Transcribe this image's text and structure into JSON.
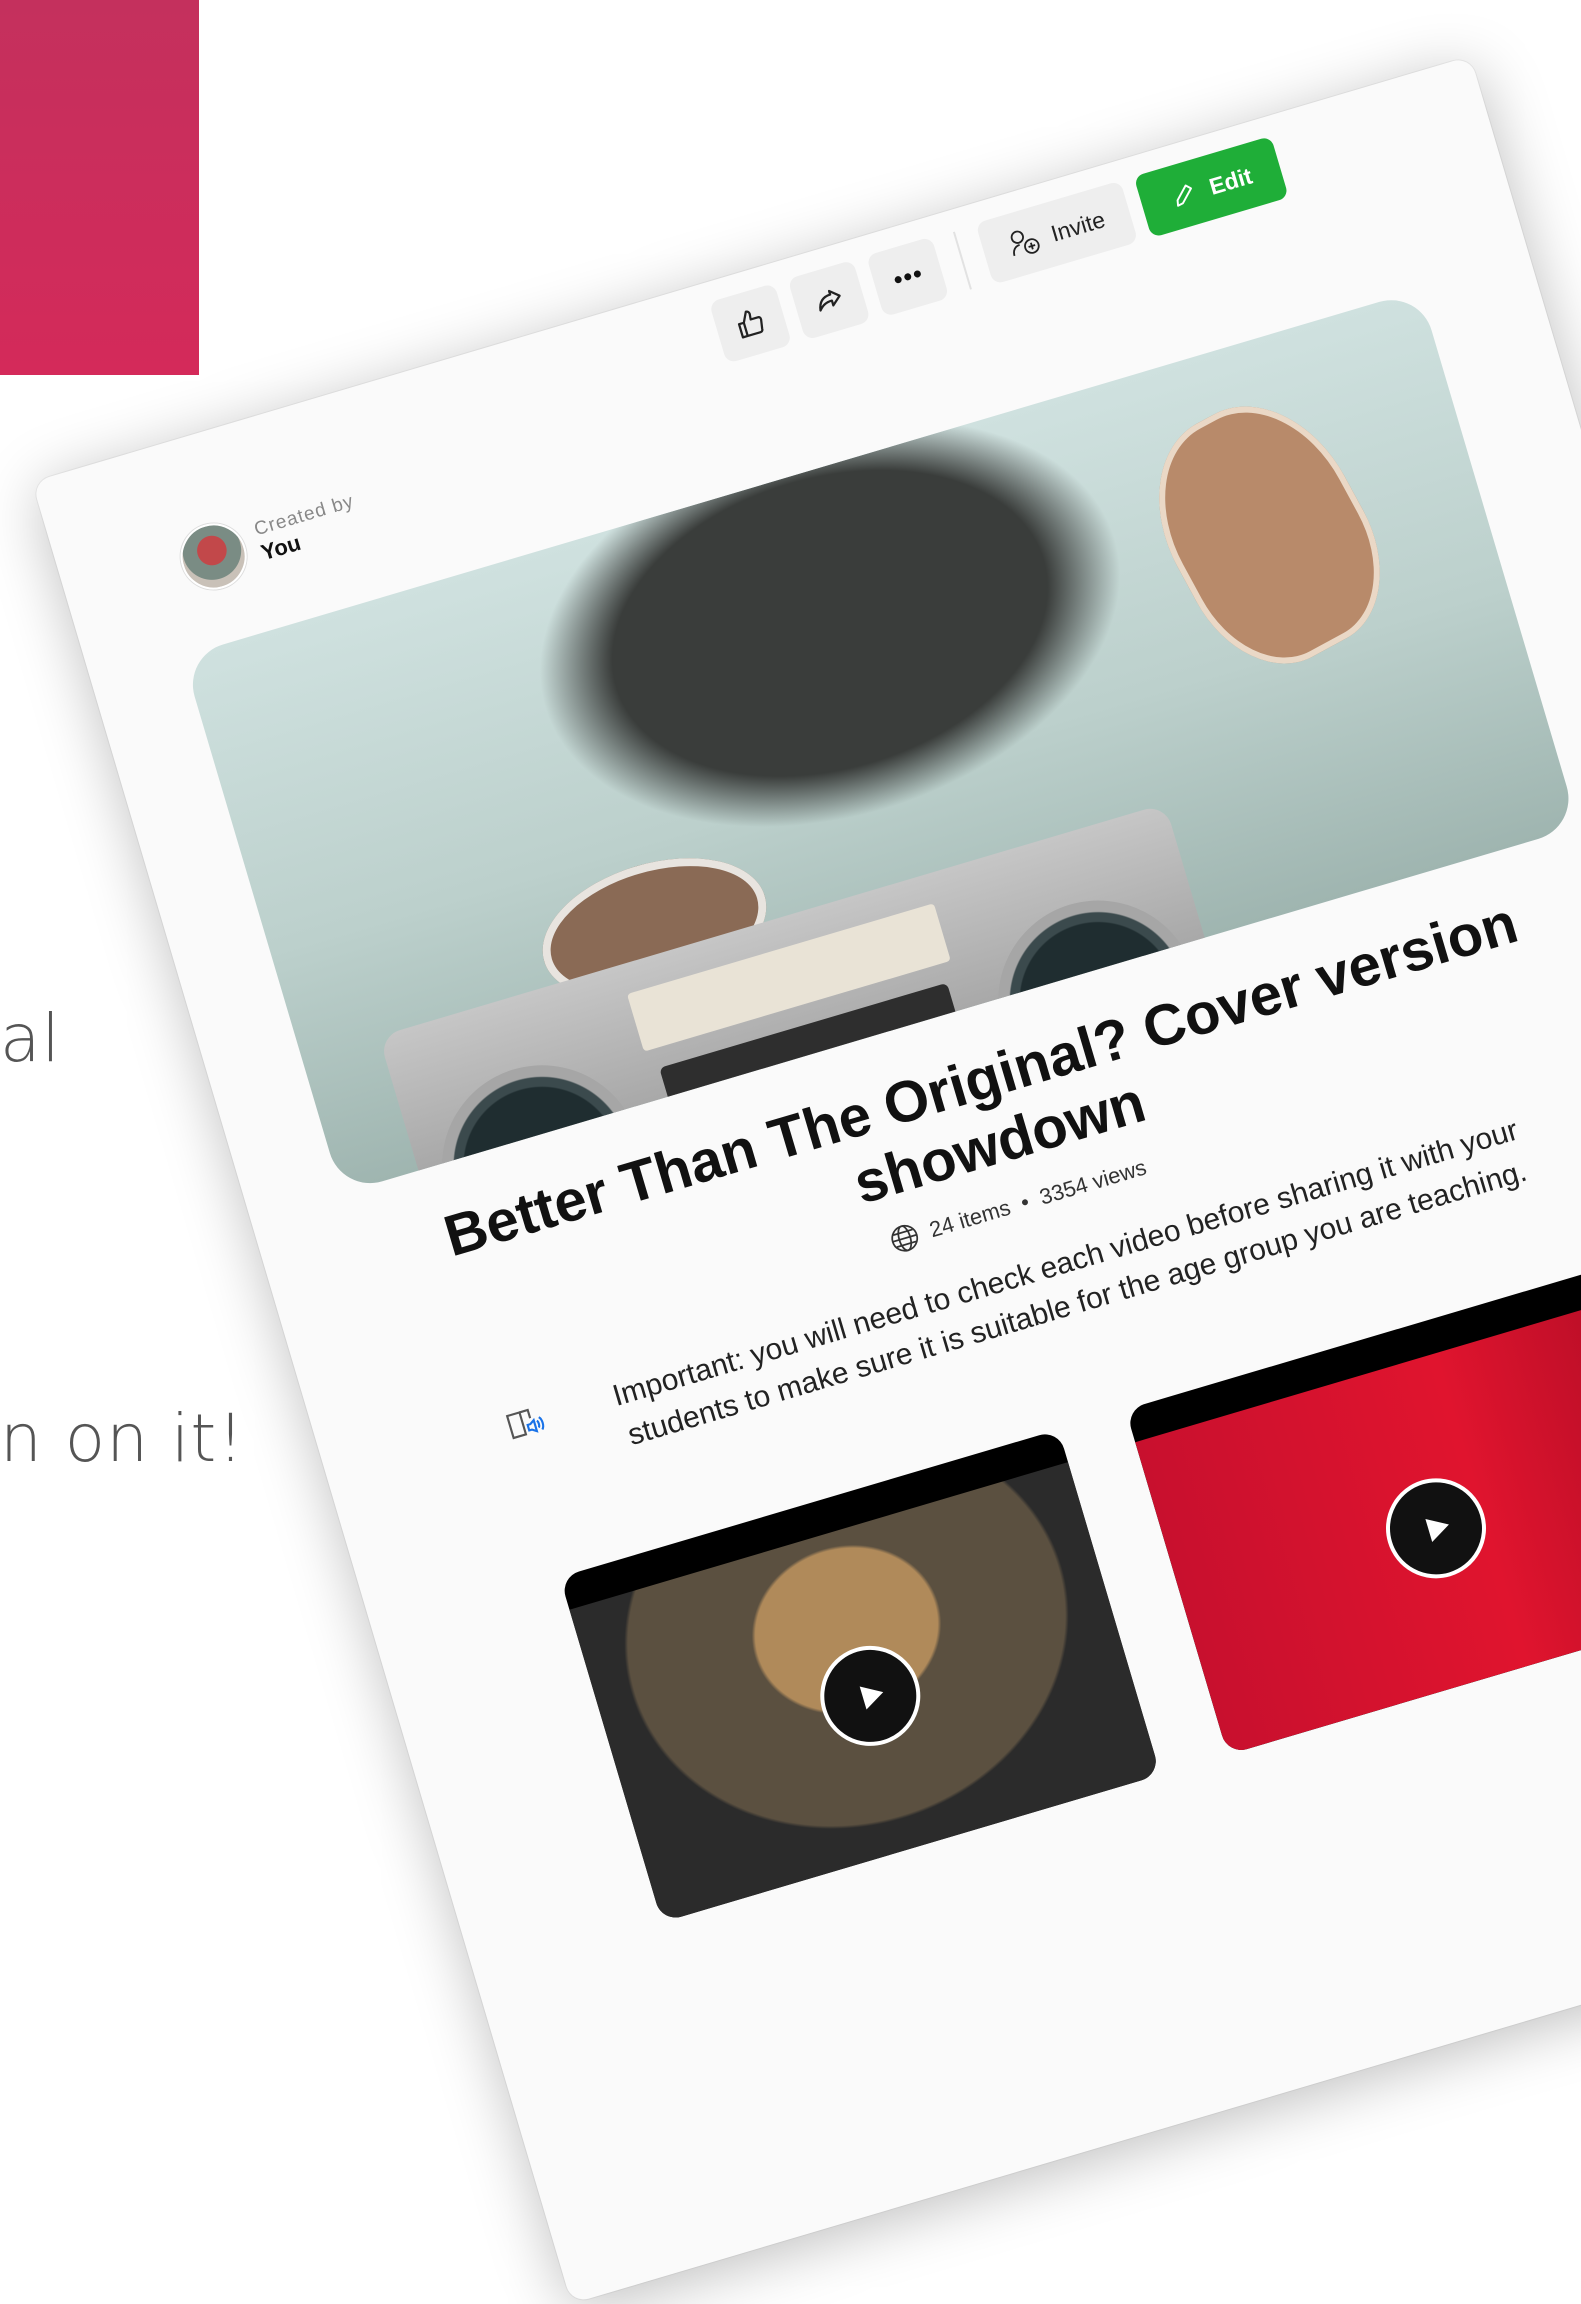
{
  "background": {
    "accent_color": "#d42a5a",
    "text_fragment_1": "al",
    "text_fragment_2": "n on it!"
  },
  "creator": {
    "label": "Created by",
    "name": "You"
  },
  "actions": {
    "like_icon": "thumbs-up-icon",
    "share_icon": "share-arrow-icon",
    "more_icon": "more-dots-icon",
    "invite_label": "Invite",
    "edit_label": "Edit",
    "edit_color": "#1fae38"
  },
  "collection": {
    "title": "Better Than The Original? Cover version showdown",
    "items": "24 items",
    "separator": "•",
    "views": "3354 views",
    "visibility_icon": "globe-icon",
    "notice": "Important: you will need to check each video before sharing it with your students to make sure it is suitable for the age group you are teaching.",
    "notice_icon": "immersive-reader-icon"
  },
  "videos": [
    {
      "name": "video-1",
      "play_icon": "play-icon"
    },
    {
      "name": "video-2",
      "play_icon": "play-icon"
    }
  ]
}
